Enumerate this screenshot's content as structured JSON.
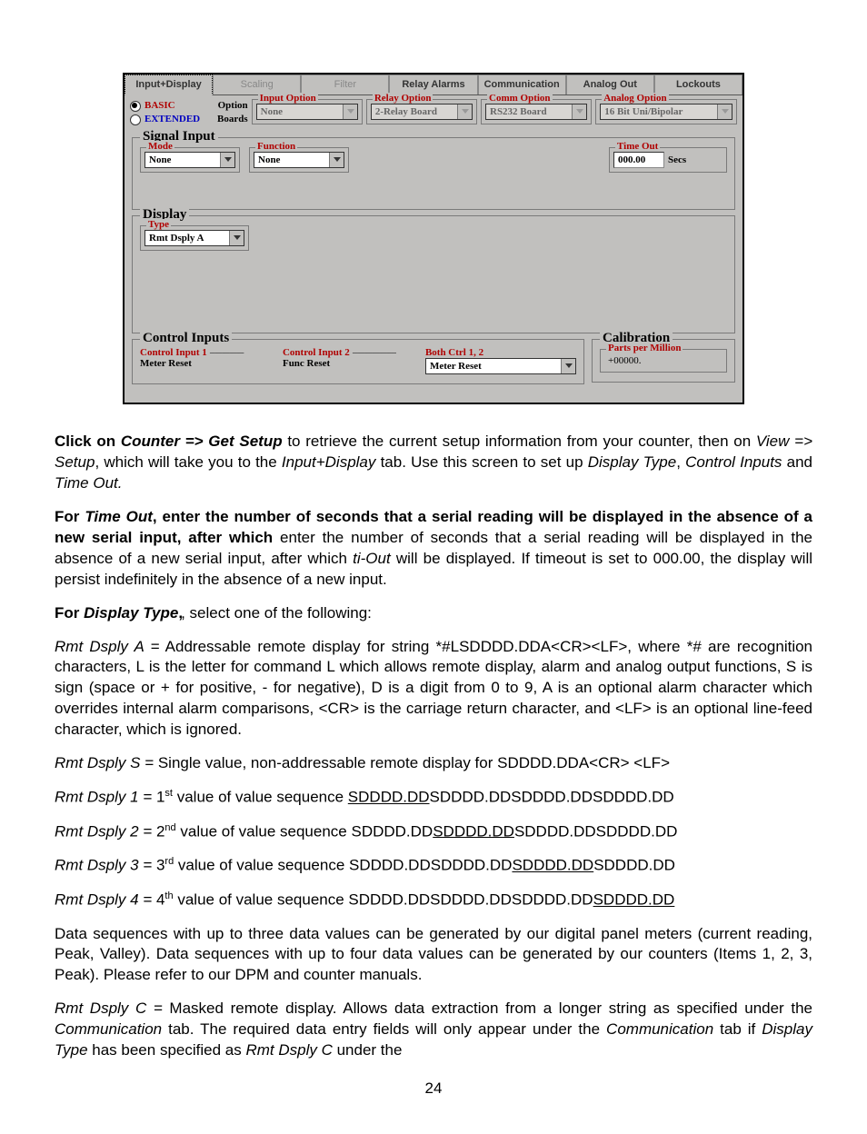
{
  "tabs": [
    "Input+Display",
    "Scaling",
    "Filter",
    "Relay Alarms",
    "Communication",
    "Analog Out",
    "Lockouts"
  ],
  "modeBasic": "BASIC",
  "modeExtended": "EXTENDED",
  "optionLabel": "Option",
  "boardsLabel": "Boards",
  "inputOption": {
    "legend": "Input Option",
    "value": "None"
  },
  "relayOption": {
    "legend": "Relay Option",
    "value": "2-Relay Board"
  },
  "commOption": {
    "legend": "Comm Option",
    "value": "RS232 Board"
  },
  "analogOption": {
    "legend": "Analog Option",
    "value": "16 Bit Uni/Bipolar"
  },
  "signalInput": {
    "legend": "Signal Input",
    "mode": {
      "legend": "Mode",
      "value": "None"
    },
    "function": {
      "legend": "Function",
      "value": "None"
    },
    "timeout": {
      "legend": "Time Out",
      "value": "000.00",
      "unit": "Secs"
    }
  },
  "display": {
    "legend": "Display",
    "type": {
      "legend": "Type",
      "value": "Rmt Dsply A"
    }
  },
  "controlInputs": {
    "legend": "Control Inputs",
    "ci1": {
      "legend": "Control Input 1",
      "value": "Meter Reset"
    },
    "ci2": {
      "legend": "Control Input 2",
      "value": "Func Reset"
    },
    "both": {
      "legend": "Both Ctrl 1, 2",
      "value": "Meter Reset"
    }
  },
  "calibration": {
    "legend": "Calibration",
    "ppm": {
      "legend": "Parts per Million",
      "value": "+00000."
    }
  },
  "para1_a": "Click on ",
  "para1_b": "Counter => Get Setup",
  "para1_c": " to retrieve the current setup information from your counter, then on ",
  "para1_d": "View => Setup",
  "para1_e": ", which will take you to the ",
  "para1_f": "Input+Display",
  "para1_g": " tab. Use this screen to set up ",
  "para1_h": "Display Type",
  "para1_i": ", ",
  "para1_j": "Control Inputs",
  "para1_k": " and ",
  "para1_l": "Time Out.",
  "para2_a": "For ",
  "para2_b": "Time Out",
  "para2_c": ", enter the number of seconds that a serial reading will be displayed in the absence of a new serial input, after which ",
  "para2_d": "ti-Out",
  "para2_e": " will be displayed. If timeout is set to 000.00, the display will persist indefinitely in the absence of a new input.",
  "para3_a": "For ",
  "para3_b": "Display Type",
  "para3_c": ", select one of the following:",
  "rmtA_a": "Rmt Dsply A =",
  "rmtA_b": " Addressable remote display for string *#LSDDDD.DDA<CR><LF>, where *# are recognition characters, L is the letter for command L which allows remote display, alarm and analog output functions, S is sign (space or + for positive, - for negative), D is a digit from 0 to 9, A is an optional alarm character which overrides internal alarm comparisons, <CR> is the carriage return character, and <LF> is an optional line-feed character, which is ignored.",
  "rmtS_a": "Rmt Dsply S =",
  "rmtS_b": " Single value, non-addressable remote display for SDDDD.DDA<CR> <LF>",
  "seq": [
    {
      "label": "Rmt Dsply 1 = ",
      "ord": "1",
      "sup": "st",
      "mid": " value of value sequence ",
      "pre": "",
      "u": "SDDDD.DD",
      "post": "SDDDD.DDSDDDD.DDSDDDD.DD"
    },
    {
      "label": "Rmt Dsply 2 = ",
      "ord": "2",
      "sup": "nd",
      "mid": " value of value sequence ",
      "pre": "SDDDD.DD",
      "u": "SDDDD.DD",
      "post": "SDDDD.DDSDDDD.DD"
    },
    {
      "label": "Rmt Dsply 3 = ",
      "ord": "3",
      "sup": "rd",
      "mid": " value of value sequence ",
      "pre": "SDDDD.DDSDDDD.DD",
      "u": "SDDDD.DD",
      "post": "SDDDD.DD"
    },
    {
      "label": "Rmt Dsply 4 = ",
      "ord": "4",
      "sup": "th",
      "mid": " value of value sequence ",
      "pre": "SDDDD.DDSDDDD.DDSDDDD.DD",
      "u": "SDDDD.DD",
      "post": ""
    }
  ],
  "dataSeq": "Data sequences with up to three data values can be generated by our digital panel meters (current reading, Peak, Valley). Data sequences with up to four data values can be generated by our counters (Items 1, 2, 3, Peak). Please refer to our DPM and counter manuals.",
  "rmtC_a": "Rmt Dsply C =",
  "rmtC_b": " Masked remote display. Allows data extraction from a longer string as specified under the ",
  "rmtC_c": "Communication",
  "rmtC_d": " tab. The required data entry fields will only appear under the ",
  "rmtC_e": "Communication",
  "rmtC_f": " tab if ",
  "rmtC_g": "Display Type",
  "rmtC_h": " has been specified as ",
  "rmtC_i": "Rmt Dsply C",
  "rmtC_j": " under the",
  "pageNum": "24"
}
